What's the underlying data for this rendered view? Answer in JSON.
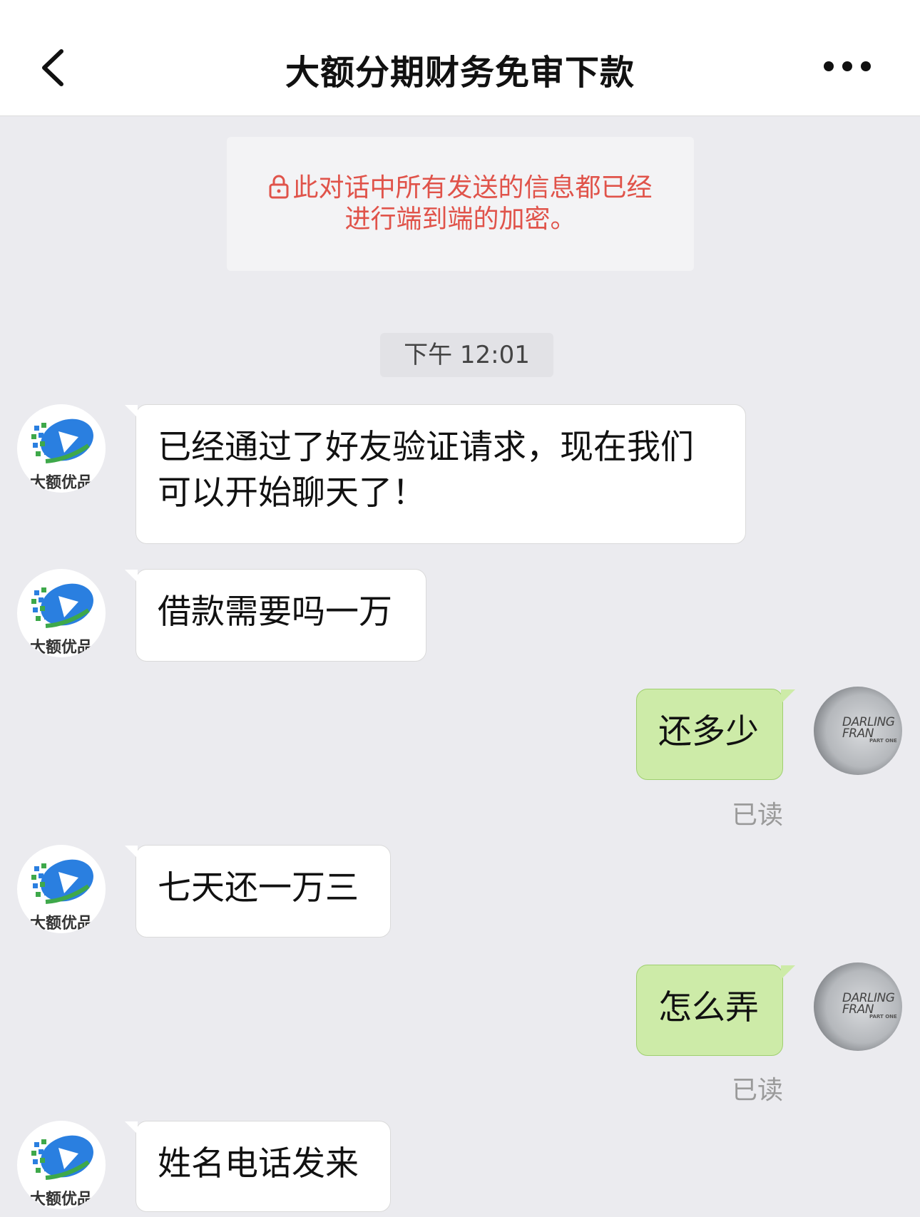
{
  "header": {
    "title": "大额分期财务免审下款",
    "back_icon": "chevron-left-icon",
    "more_icon": "more-dots-icon"
  },
  "notice": {
    "line1": "此对话中所有发送的信息都已经",
    "line2": "进行端到端的加密。",
    "color": "#e0534a"
  },
  "timestamp": "下午 12:01",
  "contact": {
    "avatar_label": "大额优品"
  },
  "user": {
    "avatar_text": "DARLING FRAN",
    "avatar_sub": "PART ONE"
  },
  "messages": [
    {
      "side": "left",
      "line1": "已经通过了好友验证请求，现在我们",
      "line2": "可以开始聊天了！"
    },
    {
      "side": "left",
      "text": "借款需要吗一万"
    },
    {
      "side": "right",
      "text": "还多少",
      "status": "已读"
    },
    {
      "side": "left",
      "text": "七天还一万三"
    },
    {
      "side": "right",
      "text": "怎么弄",
      "status": "已读"
    },
    {
      "side": "left",
      "text": "姓名电话发来"
    }
  ],
  "colors": {
    "outgoing_bubble": "#cdeba8",
    "incoming_bubble": "#ffffff",
    "background": "#ebebef"
  }
}
